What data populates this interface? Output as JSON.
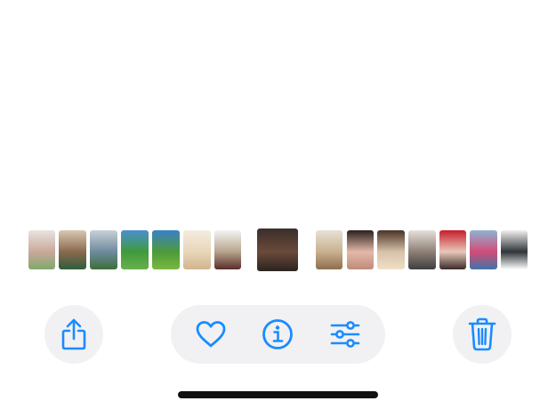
{
  "toolbar": {
    "share": {
      "icon": "share-icon"
    },
    "favorite": {
      "icon": "heart-icon"
    },
    "info": {
      "icon": "info-icon"
    },
    "adjust": {
      "icon": "sliders-icon"
    },
    "delete": {
      "icon": "trash-icon"
    }
  },
  "colors": {
    "accent": "#1a8cff",
    "button_bg": "#f1f1f3",
    "home_indicator": "#111111"
  },
  "thumbnails": [
    {
      "colors": [
        "#e8e4e0",
        "#c9a89a",
        "#7fa86a"
      ]
    },
    {
      "colors": [
        "#d9c7b0",
        "#8a6a4e",
        "#2e5d3a"
      ]
    },
    {
      "colors": [
        "#c8d0d6",
        "#6e8a9e",
        "#3c6e3a"
      ]
    },
    {
      "colors": [
        "#4a8fd1",
        "#3f9a3c",
        "#6ab04c"
      ]
    },
    {
      "colors": [
        "#3a80c8",
        "#4d9a3a",
        "#7ab83f"
      ]
    },
    {
      "colors": [
        "#f4ece0",
        "#e8d6b8",
        "#d2b48c"
      ]
    },
    {
      "colors": [
        "#f3f3f3",
        "#b7a48c",
        "#5a2d2a"
      ]
    },
    {
      "colors": [
        "#3a2f2a",
        "#6b4a3b",
        "#2b2320"
      ],
      "current": true
    },
    {
      "colors": [
        "#e7e1d6",
        "#c9b08f",
        "#8e6d4c"
      ]
    },
    {
      "colors": [
        "#2b1f1c",
        "#e3b9a8",
        "#c08a7a"
      ]
    },
    {
      "colors": [
        "#4a3326",
        "#d7c1a8",
        "#f0e0c8"
      ]
    },
    {
      "colors": [
        "#e6e0da",
        "#8e7f76",
        "#3f3f3f"
      ]
    },
    {
      "colors": [
        "#c61e2c",
        "#e8c8b8",
        "#3b2a2a"
      ]
    },
    {
      "colors": [
        "#8fb3d3",
        "#d24c78",
        "#3f74a8"
      ]
    },
    {
      "colors": [
        "#f0f0f0",
        "#303438",
        "#ffffff"
      ]
    }
  ]
}
